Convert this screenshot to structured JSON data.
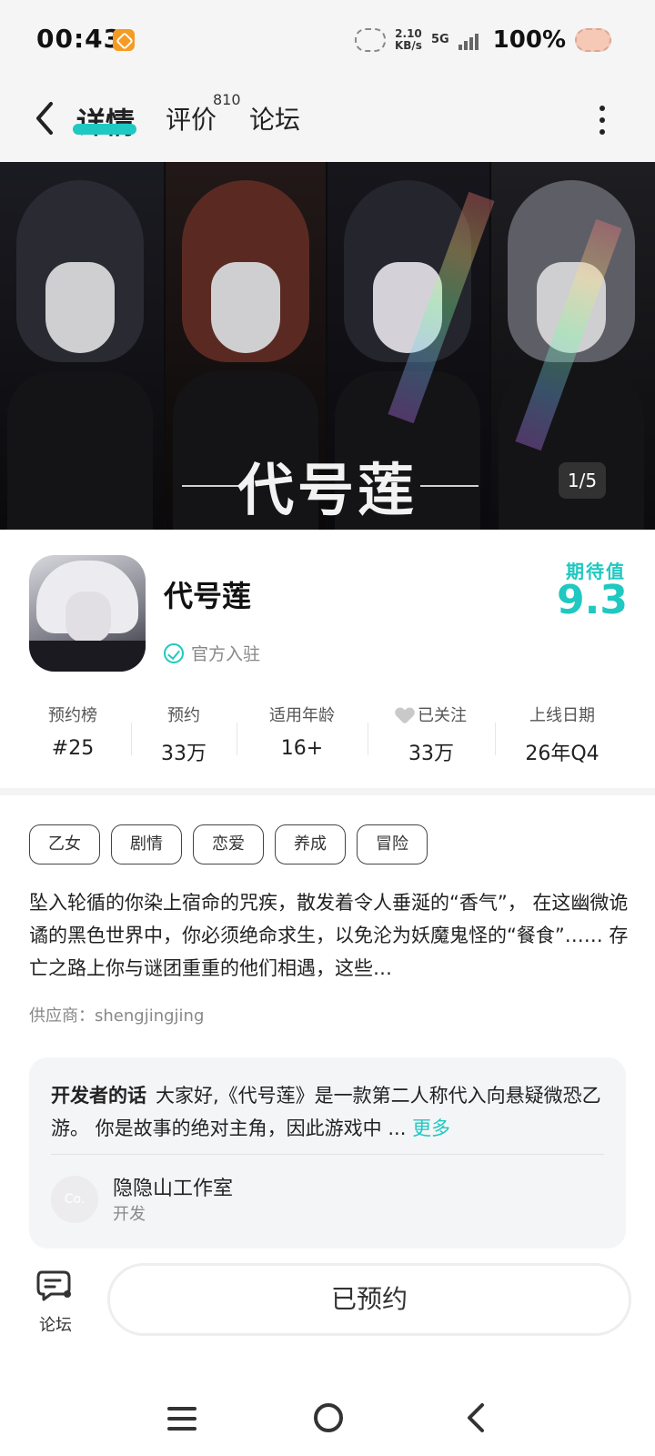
{
  "status_bar": {
    "time": "00:43",
    "net_speed_value": "2.10",
    "net_speed_unit": "KB/s",
    "network": "5G",
    "battery": "100%"
  },
  "top_nav": {
    "tabs": [
      {
        "label": "详情",
        "active": true
      },
      {
        "label": "评价",
        "badge": "810"
      },
      {
        "label": "论坛"
      }
    ]
  },
  "banner": {
    "title": "代号莲",
    "counter": "1/5"
  },
  "app": {
    "name": "代号莲",
    "verified_label": "官方入驻",
    "expect_label": "期待值",
    "expect_value": "9.3"
  },
  "stats": [
    {
      "label": "预约榜",
      "value": "#25"
    },
    {
      "label": "预约",
      "value": "33万"
    },
    {
      "label": "适用年龄",
      "value": "16+"
    },
    {
      "label": "已关注",
      "value": "33万",
      "icon": "heart-icon"
    },
    {
      "label": "上线日期",
      "value": "26年Q4"
    }
  ],
  "tags": [
    "乙女",
    "剧情",
    "恋爱",
    "养成",
    "冒险"
  ],
  "description": "坠入轮循的你染上宿命的咒疾，散发着令人垂涎的“香气”， 在这幽微诡谲的黑色世界中，你必须绝命求生，以免沦为妖魔鬼怪的“餐食”…… 存亡之路上你与谜团重重的他们相遇，这些…",
  "supplier": "供应商：shengjingjing",
  "developer": {
    "words_title": "开发者的话",
    "words": "大家好,《代号莲》是一款第二人称代入向悬疑微恐乙游。 你是故事的绝对主角，因此游戏中 ...",
    "more": "更多",
    "avatar_text": "Co.",
    "studio": "隐隐山工作室",
    "role": "开发"
  },
  "actions": {
    "forum_label": "论坛",
    "reserve_label": "已预约"
  },
  "colors": {
    "accent": "#1fc8c0"
  }
}
